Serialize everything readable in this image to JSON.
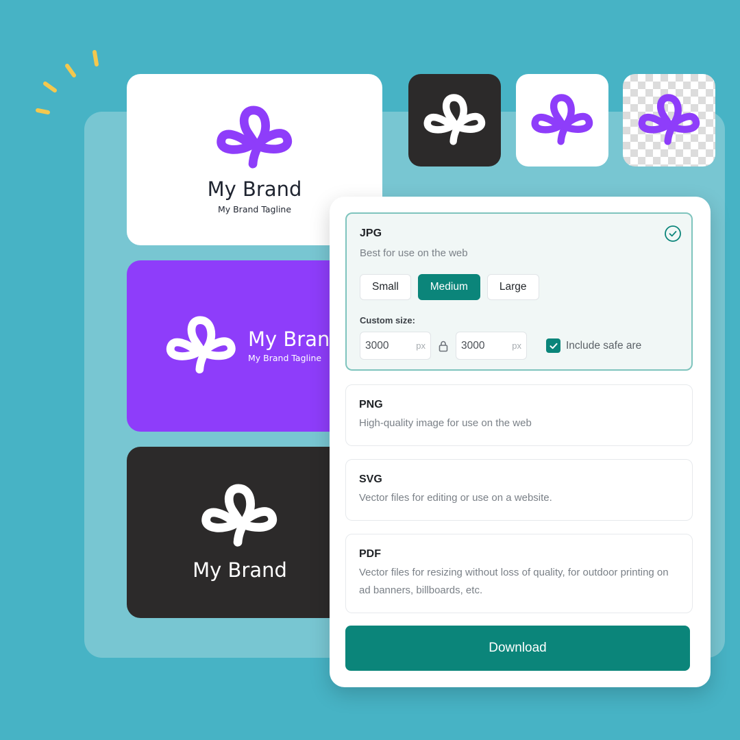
{
  "colors": {
    "background": "#47b3c5",
    "backdrop": "#78c6d2",
    "brand_purple": "#8e3dfa",
    "dark": "#2c2a2a",
    "accent_teal": "#0b857a",
    "sparks": "#f4c84e"
  },
  "brand_cards": [
    {
      "variant": "light",
      "name": "My Brand",
      "tagline": "My Brand Tagline"
    },
    {
      "variant": "purple",
      "name": "My Bran",
      "tagline": "My Brand Tagline"
    },
    {
      "variant": "dark",
      "name": "My Brand"
    }
  ],
  "logo_swatches": [
    {
      "variant": "dark-background",
      "icon": "logo-icon"
    },
    {
      "variant": "white-background",
      "icon": "logo-icon"
    },
    {
      "variant": "transparent-background",
      "icon": "logo-icon"
    }
  ],
  "download_panel": {
    "formats": [
      {
        "title": "JPG",
        "description": "Best for use on the web",
        "selected": true,
        "sizes": [
          "Small",
          "Medium",
          "Large"
        ],
        "active_size": "Medium",
        "custom_size_label": "Custom size:",
        "width": "3000",
        "height": "3000",
        "unit": "px",
        "safe_area_label": "Include safe are",
        "safe_area_checked": true
      },
      {
        "title": "PNG",
        "description": "High-quality image for use on the web",
        "selected": false
      },
      {
        "title": "SVG",
        "description": "Vector files for editing or use on a website.",
        "selected": false
      },
      {
        "title": "PDF",
        "description": "Vector files for resizing without loss of quality, for outdoor printing on ad banners, billboards, etc.",
        "selected": false
      }
    ],
    "download_label": "Download"
  }
}
